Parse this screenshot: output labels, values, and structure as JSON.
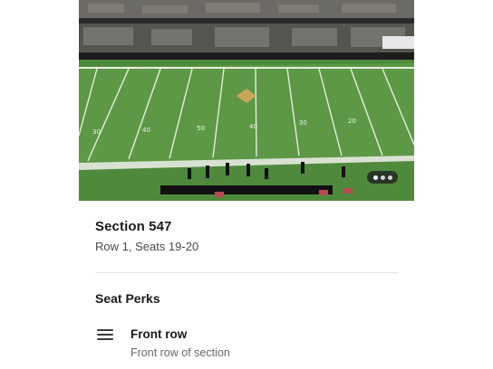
{
  "photo": {
    "alt": "View of the football field from the seat",
    "carousel_dots": 3,
    "active_dot": 0
  },
  "section": {
    "title": "Section 547",
    "row_seats": "Row 1, Seats 19-20"
  },
  "perks": {
    "heading": "Seat Perks",
    "items": [
      {
        "icon": "front-row-icon",
        "title": "Front row",
        "description": "Front row of section"
      }
    ]
  },
  "colors": {
    "field_green": "#4f8a3c",
    "stripe_green": "#5c9845",
    "text_dark": "#1a1a1a",
    "text_muted": "#6a6a6a"
  }
}
